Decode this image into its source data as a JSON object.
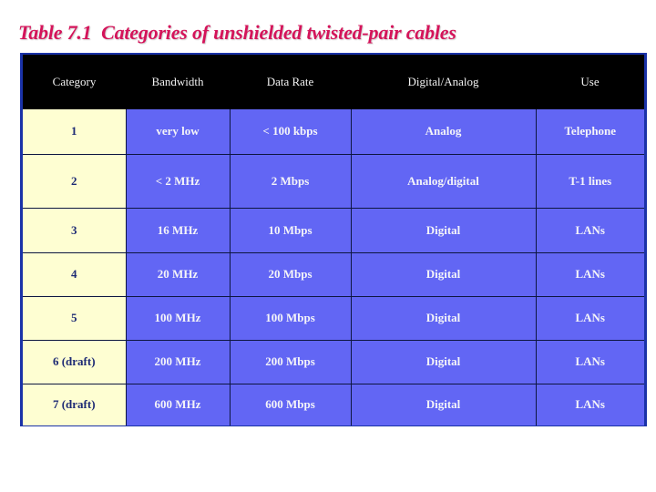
{
  "title": "Table 7.1  Categories of unshielded twisted-pair cables",
  "colors": {
    "title": "#d4145a",
    "header_bg": "#000000",
    "category_bg": "#fefed2",
    "cell_bg": "#6266f4",
    "frame": "#1a32a8"
  },
  "table": {
    "headers": [
      "Category",
      "Bandwidth",
      "Data Rate",
      "Digital/Analog",
      "Use"
    ],
    "rows": [
      [
        "1",
        "very low",
        "< 100 kbps",
        "Analog",
        "Telephone"
      ],
      [
        "2",
        "< 2 MHz",
        "2 Mbps",
        "Analog/digital",
        "T-1 lines"
      ],
      [
        "3",
        "16 MHz",
        "10 Mbps",
        "Digital",
        "LANs"
      ],
      [
        "4",
        "20 MHz",
        "20 Mbps",
        "Digital",
        "LANs"
      ],
      [
        "5",
        "100 MHz",
        "100 Mbps",
        "Digital",
        "LANs"
      ],
      [
        "6 (draft)",
        "200 MHz",
        "200 Mbps",
        "Digital",
        "LANs"
      ],
      [
        "7 (draft)",
        "600 MHz",
        "600 Mbps",
        "Digital",
        "LANs"
      ]
    ]
  }
}
